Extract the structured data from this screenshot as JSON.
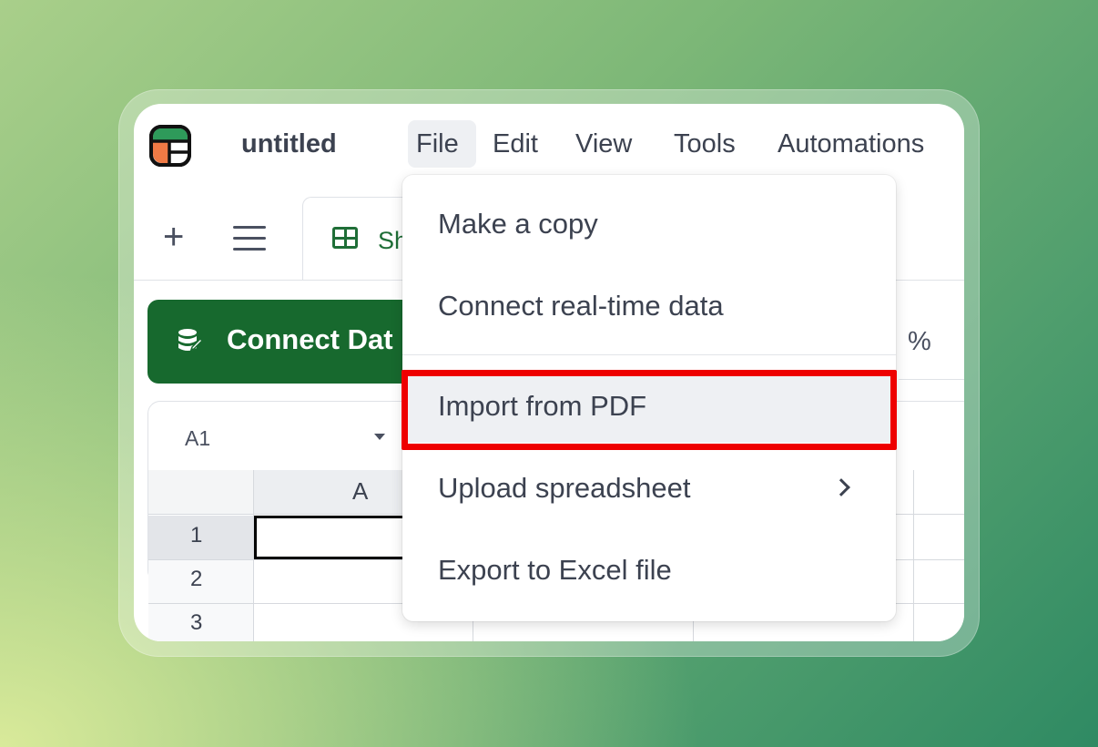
{
  "app": {
    "doc_title": "untitled",
    "menubar": [
      "File",
      "Edit",
      "View",
      "Tools",
      "Automations"
    ]
  },
  "toolbar": {
    "plus_symbol": "+",
    "sheet_tab_label": "Sh",
    "connect_button_label": "Connect Dat",
    "percent_symbol": "%"
  },
  "formula_bar": {
    "cell_reference": "A1"
  },
  "grid": {
    "column_headers": [
      "A"
    ],
    "row_headers": [
      "1",
      "2",
      "3"
    ],
    "selected_cell": "A1"
  },
  "file_menu": {
    "items": [
      {
        "label": "Make a copy"
      },
      {
        "label": "Connect real-time data"
      },
      {
        "label": "Import from PDF"
      },
      {
        "label": "Upload spreadsheet"
      },
      {
        "label": "Export to Excel file"
      }
    ],
    "highlighted_item": "Import from PDF",
    "submenu_indicator": "chevron-right-icon"
  },
  "colors": {
    "brand_green": "#17692e",
    "highlight_red": "#ee0000",
    "logo_orange": "#f07a45",
    "logo_green": "#2e9a5a"
  }
}
